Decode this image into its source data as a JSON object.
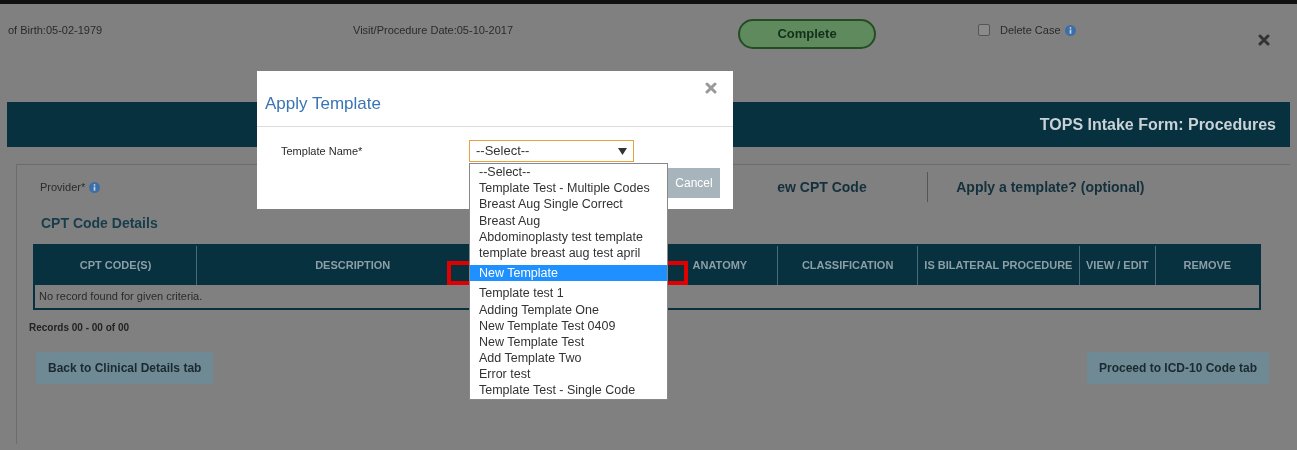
{
  "header": {
    "birth_date": "of Birth:05-02-1979",
    "visit_date": "Visit/Procedure Date:05-10-2017",
    "complete_button": "Complete",
    "delete_case": {
      "label": "Delete Case",
      "checked": false
    }
  },
  "form_bar": {
    "title": "TOPS Intake Form: Procedures"
  },
  "provider": {
    "label": "Provider*"
  },
  "cpt_link": "ew CPT Code",
  "template_link": "Apply a template? (optional)",
  "cpt_details": {
    "title": "CPT Code Details",
    "columns": [
      "CPT CODE(S)",
      "DESCRIPTION",
      "ANATOMY",
      "CLASSIFICATION",
      "IS BILATERAL PROCEDURE",
      "VIEW / EDIT",
      "REMOVE"
    ],
    "empty_message": "No record found for given criteria.",
    "records": "Records 00 - 00 of 00"
  },
  "buttons": {
    "back": "Back to Clinical Details tab",
    "proceed": "Proceed to ICD-10 Code tab"
  },
  "dialog": {
    "title": "Apply Template",
    "field_label": "Template Name*",
    "select_value": "--Select--",
    "cancel": "Cancel",
    "options": [
      {
        "label": "--Select--",
        "selected": false
      },
      {
        "label": "Template Test - Multiple Codes",
        "selected": false
      },
      {
        "label": "Breast Aug Single Correct",
        "selected": false
      },
      {
        "label": "Breast Aug",
        "selected": false
      },
      {
        "label": "Abdominoplasty test template",
        "selected": false
      },
      {
        "label": "template breast aug test april",
        "selected": false
      },
      {
        "label": "New Template",
        "selected": true
      },
      {
        "label": "Template test 1",
        "selected": false
      },
      {
        "label": "Adding Template One",
        "selected": false
      },
      {
        "label": "New Template Test 0409",
        "selected": false
      },
      {
        "label": "New Template Test",
        "selected": false
      },
      {
        "label": "Add Template Two",
        "selected": false
      },
      {
        "label": "Error test",
        "selected": false
      },
      {
        "label": "Template Test - Single Code",
        "selected": false
      }
    ]
  }
}
